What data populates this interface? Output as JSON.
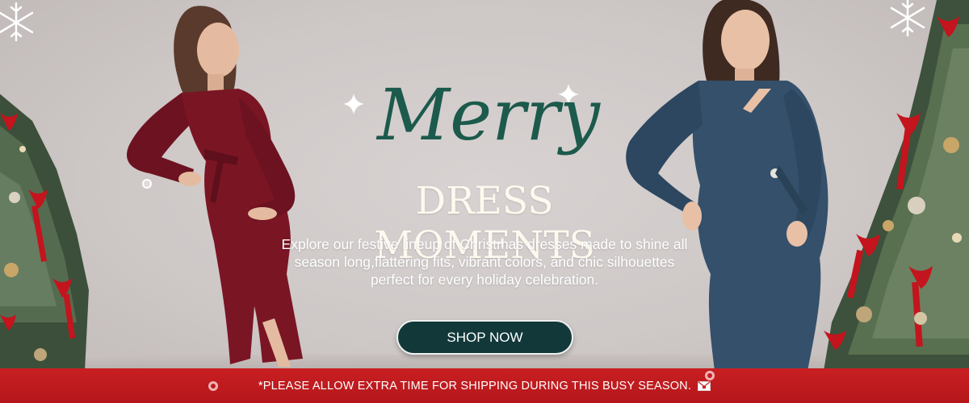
{
  "banner": {
    "script_title": "Merry",
    "headline": "DRESS MOMENTS",
    "body": "Explore our festive lineup of Christmas dresses made to shine all season long,flattering fits, vibrant colors, and chic silhouettes perfect for every holiday celebration.",
    "cta_label": "SHOP NOW"
  },
  "notice": {
    "text": "*PLEASE ALLOW EXTRA TIME FOR SHIPPING DURING THIS BUSY SEASON."
  },
  "colors": {
    "script_green": "#1c5a4c",
    "cta_bg": "#12383a",
    "notice_red": "#c81f22",
    "dress_left": "#7a1524",
    "dress_right": "#34506b"
  },
  "icons": [
    "snowflake-icon",
    "sparkle-icon",
    "envelope-icon"
  ]
}
